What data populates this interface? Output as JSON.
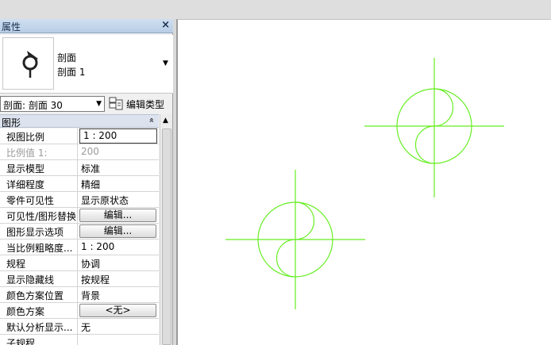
{
  "panel": {
    "title": "属性",
    "close_glyph": "×",
    "type_selector": {
      "family": "剖面",
      "type": "剖面 1",
      "icon": "section-marker-icon"
    },
    "instance_selector": {
      "value": "剖面: 剖面 30",
      "edit_type_label": "编辑类型",
      "edit_type_icon": "edit-type-icon"
    },
    "group": {
      "label": "图形",
      "collapse_glyph": "»"
    },
    "properties": [
      {
        "name": "视图比例",
        "value": "1 : 200",
        "kind": "boxed"
      },
      {
        "name": "比例值 1:",
        "value": "200",
        "kind": "dim"
      },
      {
        "name": "显示模型",
        "value": "标准",
        "kind": "text"
      },
      {
        "name": "详细程度",
        "value": "精细",
        "kind": "text"
      },
      {
        "name": "零件可见性",
        "value": "显示原状态",
        "kind": "text"
      },
      {
        "name": "可见性/图形替换",
        "value": "编辑...",
        "kind": "button"
      },
      {
        "name": "图形显示选项",
        "value": "编辑...",
        "kind": "button"
      },
      {
        "name": "当比例粗略度...",
        "value": "1 : 200",
        "kind": "text"
      },
      {
        "name": "规程",
        "value": "协调",
        "kind": "text"
      },
      {
        "name": "显示隐藏线",
        "value": "按规程",
        "kind": "text"
      },
      {
        "name": "颜色方案位置",
        "value": "背景",
        "kind": "text"
      },
      {
        "name": "颜色方案",
        "value": "<无>",
        "kind": "button"
      },
      {
        "name": "默认分析显示...",
        "value": "无",
        "kind": "text"
      },
      {
        "name": "子规程",
        "value": "",
        "kind": "text"
      }
    ]
  },
  "canvas": {
    "line_color": "#66ee22",
    "symbols": [
      {
        "name": "upper-right-symbol"
      },
      {
        "name": "lower-left-symbol"
      }
    ]
  }
}
